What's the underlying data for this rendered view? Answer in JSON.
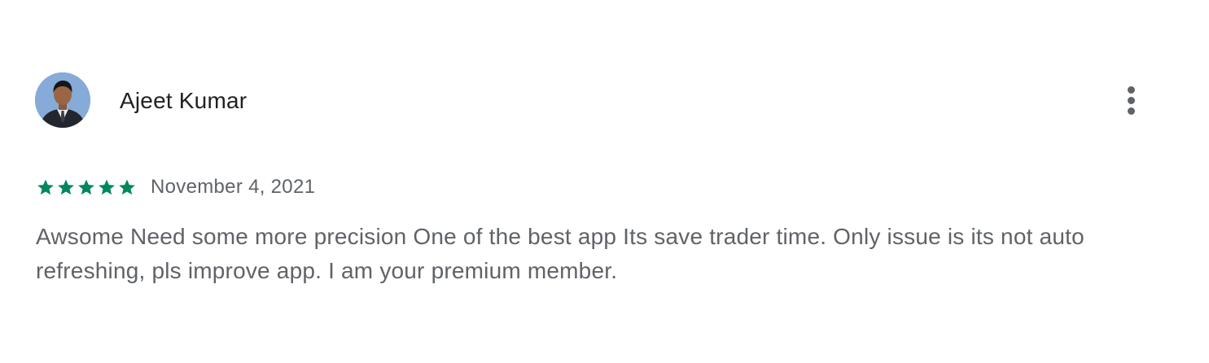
{
  "review": {
    "author": "Ajeet Kumar",
    "avatar_icon": "user-photo",
    "rating": 5,
    "rating_max": 5,
    "star_color": "#01875f",
    "date": "November 4, 2021",
    "text": "Awsome Need some more precision One of the best app Its save trader time. Only issue is its not auto refreshing, pls improve app. I am your premium member.",
    "more_icon": "more-vert-icon"
  }
}
